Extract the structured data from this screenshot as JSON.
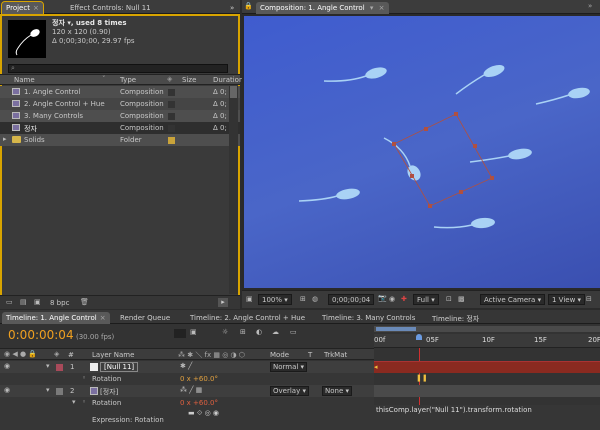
{
  "project": {
    "tabs": [
      {
        "label": "Project",
        "close": "×"
      },
      {
        "label": "Effect Controls: Null 11",
        "close": "»"
      }
    ],
    "item_name": "정자 ▾, used 8 times",
    "item_dims": "120 x 120 (0.90)",
    "item_duration": "Δ 0;00;30;00, 29.97 fps",
    "search_placeholder": "",
    "columns": [
      "Name",
      "Type",
      "Size",
      "Duration"
    ],
    "items": [
      {
        "name": "1. Angle Control",
        "type": "Composition",
        "duration": "Δ 0;"
      },
      {
        "name": "2. Angle Control + Hue",
        "type": "Composition",
        "duration": "Δ 0;"
      },
      {
        "name": "3. Many Controls",
        "type": "Composition",
        "duration": "Δ 0;"
      },
      {
        "name": "정자",
        "type": "Composition",
        "duration": "Δ 0;"
      },
      {
        "name": "Solids",
        "type": "Folder",
        "duration": ""
      }
    ],
    "bpc": "8 bpc"
  },
  "composition": {
    "tab": "Composition: 1. Angle Control",
    "zoom": "100%",
    "timecode": "0;00;00;04",
    "resolution": "Full",
    "camera": "Active Camera",
    "view": "1 View"
  },
  "timeline": {
    "tabs": [
      "Timeline: 1. Angle Control",
      "Render Queue",
      "Timeline: 2. Angle Control + Hue",
      "Timeline: 3. Many Controls",
      "Timeline: 정자"
    ],
    "timecode": "0:00:00:04",
    "fps": "(30.00 fps)",
    "columns": {
      "hash": "#",
      "layer_name": "Layer Name",
      "mode": "Mode",
      "t": "T",
      "trkmat": "TrkMat"
    },
    "ruler": [
      "00f",
      "05F",
      "10F",
      "15F",
      "20F"
    ],
    "layers": [
      {
        "num": "1",
        "name": "[Null 11]",
        "mode": "Normal",
        "prop": "Rotation",
        "value": "0 x +60.0°"
      },
      {
        "num": "2",
        "name": "[정자]",
        "mode": "Overlay",
        "trkmat": "None",
        "prop": "Rotation",
        "value": "0 x +60.0°",
        "expr_label": "Expression: Rotation"
      }
    ],
    "expression": "thisComp.layer(\"Null 11\").transform.rotation"
  },
  "colors": {
    "accent": "#d8a400",
    "comp_bg": "#4a66c8",
    "red_bar": "#8a2a20",
    "timecode": "#f0a020"
  }
}
